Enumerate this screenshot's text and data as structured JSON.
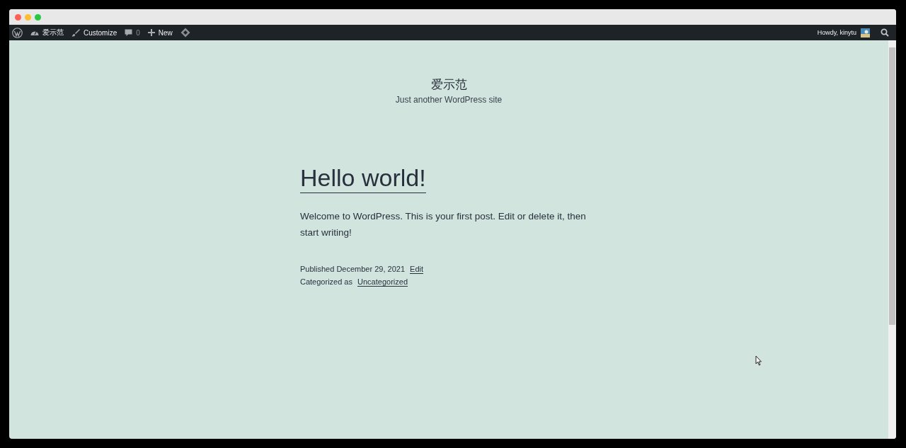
{
  "admin_bar": {
    "left": [
      {
        "kind": "logo"
      },
      {
        "kind": "site",
        "label": "爱示范"
      },
      {
        "kind": "customize",
        "label": "Customize"
      },
      {
        "kind": "comments",
        "label": "0"
      },
      {
        "kind": "new",
        "label": "New"
      },
      {
        "kind": "diamond"
      }
    ],
    "greeting": "Howdy, kinytu"
  },
  "site": {
    "title": "爱示范",
    "tagline": "Just another WordPress site"
  },
  "post": {
    "title": "Hello world!",
    "body": "Welcome to WordPress. This is your first post. Edit or delete it, then start writing!",
    "published_label": "Published",
    "date": "December 29, 2021",
    "edit_link": "Edit",
    "category_label": "Categorized as",
    "category": "Uncategorized"
  }
}
